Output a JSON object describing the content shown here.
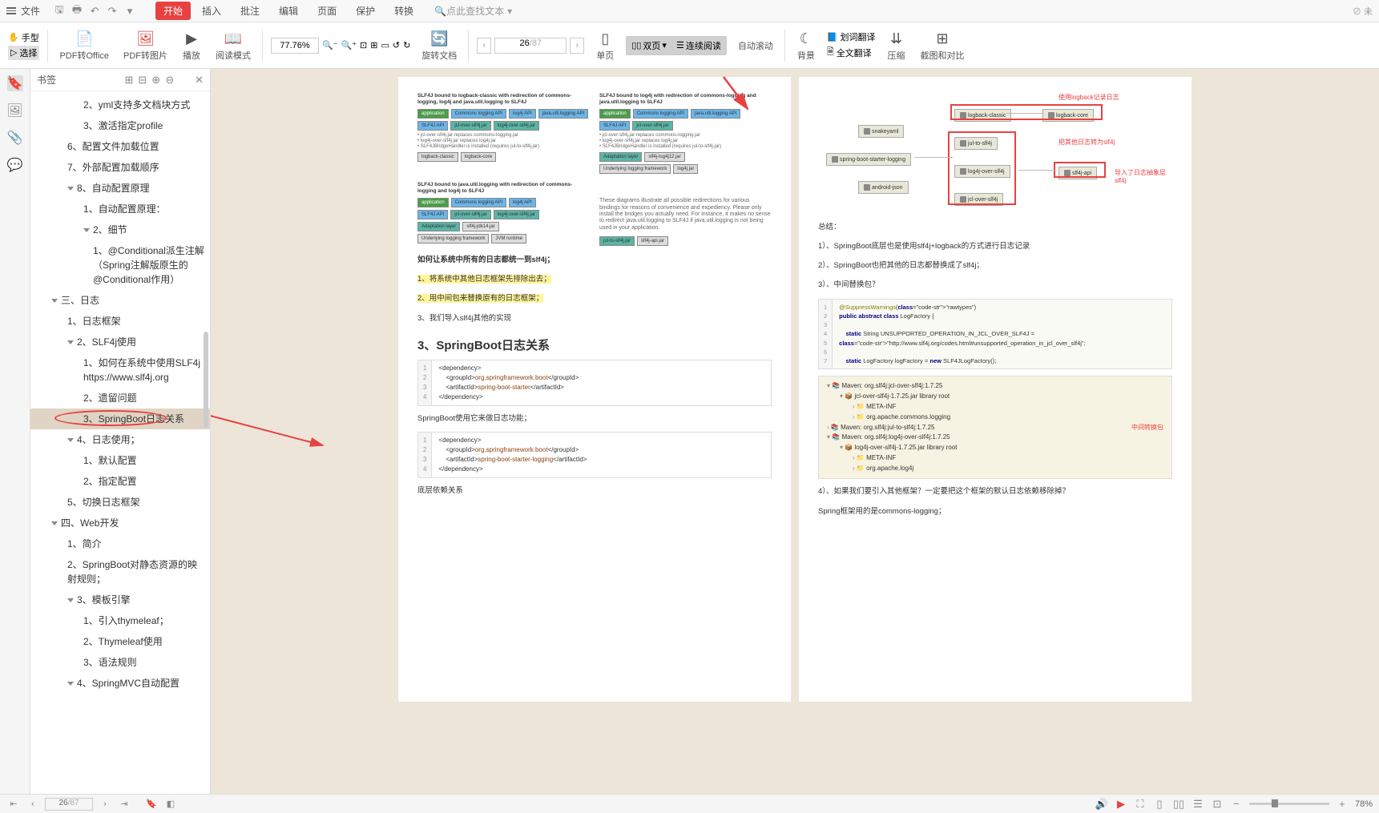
{
  "menubar": {
    "file": "文件",
    "start": "开始",
    "insert": "插入",
    "annotate": "批注",
    "edit": "编辑",
    "page": "页面",
    "protect": "保护",
    "convert": "转换",
    "search_placeholder": "点此查找文本",
    "unsaved": "未"
  },
  "ribbon": {
    "hand": "手型",
    "select": "选择",
    "pdf2office": "PDF转Office",
    "pdf2img": "PDF转图片",
    "play": "播放",
    "read_mode": "阅读模式",
    "zoom_value": "77.76%",
    "rotate": "旋转文档",
    "page_current": "26",
    "page_total": "/87",
    "single": "单页",
    "double": "双页",
    "continuous": "连续阅读",
    "autoscroll": "自动滚动",
    "background": "背景",
    "dict_translate": "划词翻译",
    "full_translate": "全文翻译",
    "compress": "压缩",
    "screenshot_compare": "截图和对比"
  },
  "bookmark": {
    "title": "书签",
    "items": [
      {
        "lvl": 3,
        "text": "2、yml支持多文档块方式"
      },
      {
        "lvl": 3,
        "text": "3、激活指定profile"
      },
      {
        "lvl": 2,
        "text": "6、配置文件加载位置"
      },
      {
        "lvl": 2,
        "text": "7、外部配置加载顺序"
      },
      {
        "lvl": 2,
        "text": "8、自动配置原理",
        "caret": true
      },
      {
        "lvl": 3,
        "text": "1、自动配置原理："
      },
      {
        "lvl": 3,
        "text": "2、细节",
        "caret": true
      },
      {
        "lvl": 4,
        "text": "1、@Conditional派生注解（Spring注解版原生的@Conditional作用）"
      },
      {
        "lvl": 1,
        "text": "三、日志",
        "caret": true
      },
      {
        "lvl": 2,
        "text": "1、日志框架"
      },
      {
        "lvl": 2,
        "text": "2、SLF4j使用",
        "caret": true
      },
      {
        "lvl": 3,
        "text": "1、如何在系统中使用SLF4j   https://www.slf4j.org"
      },
      {
        "lvl": 3,
        "text": "2、遗留问题"
      },
      {
        "lvl": 3,
        "text": "3、SpringBoot日志关系",
        "selected": true
      },
      {
        "lvl": 2,
        "text": "4、日志使用；",
        "caret": true
      },
      {
        "lvl": 3,
        "text": "1、默认配置"
      },
      {
        "lvl": 3,
        "text": "2、指定配置"
      },
      {
        "lvl": 2,
        "text": "5、切换日志框架"
      },
      {
        "lvl": 1,
        "text": "四、Web开发",
        "caret": true
      },
      {
        "lvl": 2,
        "text": "1、简介"
      },
      {
        "lvl": 2,
        "text": "2、SpringBoot对静态资源的映射规则；"
      },
      {
        "lvl": 2,
        "text": "3、模板引擎",
        "caret": true
      },
      {
        "lvl": 3,
        "text": "1、引入thymeleaf；"
      },
      {
        "lvl": 3,
        "text": "2、Thymeleaf使用"
      },
      {
        "lvl": 3,
        "text": "3、语法规则"
      },
      {
        "lvl": 2,
        "text": "4、SpringMVC自动配置",
        "caret": true
      }
    ]
  },
  "page_left": {
    "diag1_title": "SLF4J bound to logback-classic with redirection of commons-logging, log4j and java.util.logging to SLF4J",
    "diag2_title": "SLF4J bound to log4j with redirection of commons-logging and java.util.logging to SLF4J",
    "diag3_title": "SLF4J bound to java.util.logging with redirection of commons-logging and log4j to SLF4J",
    "diag4_text": "These diagrams illustrate all possible redirections for various bindings for reasons of convenience and expediency. Please only install the bridges you actually need. For instance, it makes no sense to redirect java.util.logging to SLF4J if java.util.logging is not being used in your application.",
    "diag_note1": "• jcl-over-slf4j.jar replaces commons-logging.jar\n• log4j-over-slf4j.jar replaces log4j.jar\n• SLF4JBridgeHandler is installed (requires jul-to-slf4j.jar)",
    "body_q": "如何让系统中所有的日志都统一到slf4j；",
    "body_1": "1、将系统中其他日志框架先排除出去；",
    "body_2": "2、用中间包来替换原有的日志框架；",
    "body_3": "3、我们导入slf4j其他的实现",
    "section": "3、SpringBoot日志关系",
    "code1": {
      "lines": [
        "<dependency>",
        "    <groupId>org.springframework.boot</groupId>",
        "    <artifactId>spring-boot-starter</artifactId>",
        "</dependency>"
      ]
    },
    "body_4": "SpringBoot使用它来做日志功能；",
    "code2": {
      "lines": [
        "<dependency>",
        "    <groupId>org.springframework.boot</groupId>",
        "    <artifactId>spring-boot-starter-logging</artifactId>",
        "</dependency>"
      ]
    },
    "body_5": "底层依赖关系"
  },
  "page_right": {
    "dep_boxes": {
      "snakeyaml": "snakeyaml",
      "starter": "spring-boot-starter-logging",
      "android": "android-json",
      "logback_classic": "logback-classic",
      "logback_core": "logback-core",
      "jul_to_slf4j": "jul-to-slf4j",
      "log4j_over": "log4j-over-slf4j",
      "jcl_over": "jcl-over-slf4j",
      "slf4j_api": "slf4j-api"
    },
    "labels": {
      "use_logback": "使用logback记录日志",
      "convert_other": "把其他日志转为slf4j",
      "import_abstract": "导入了日志抽象层slf4j"
    },
    "summary": "总结：",
    "point1": "1）、SpringBoot底层也是使用slf4j+logback的方式进行日志记录",
    "point2": "2）、SpringBoot也把其他的日志都替换成了slf4j；",
    "point3": "3）、中间替换包？",
    "code3": {
      "lines": [
        "@SuppressWarnings(\"rawtypes\")",
        "public abstract class LogFactory {",
        "",
        "    static String UNSUPPORTED_OPERATION_IN_JCL_OVER_SLF4J =",
        "\"http://www.slf4j.org/codes.html#unsupported_operation_in_jcl_over_slf4j\";",
        "",
        "    static LogFactory logFactory = new SLF4JLogFactory();"
      ]
    },
    "tree": {
      "l0": "Maven: org.slf4j:jcl-over-slf4j:1.7.25",
      "l1": "jcl-over-slf4j-1.7.25.jar  library root",
      "l2": "META-INF",
      "l3": "org.apache.commons.logging",
      "l4": "Maven: org.slf4j:jul-to-slf4j:1.7.25",
      "l5": "Maven: org.slf4j:log4j-over-slf4j:1.7.25",
      "l6": "log4j-over-slf4j-1.7.25.jar  library root",
      "l7": "META-INF",
      "l8": "org.apache.log4j",
      "red": "中间转换包"
    },
    "point4": "4）、如果我们要引入其他框架？一定要把这个框架的默认日志依赖移除掉？",
    "point5": "Spring框架用的是commons-logging；"
  },
  "statusbar": {
    "page_current": "26",
    "page_total": "/87",
    "zoom": "78%"
  }
}
